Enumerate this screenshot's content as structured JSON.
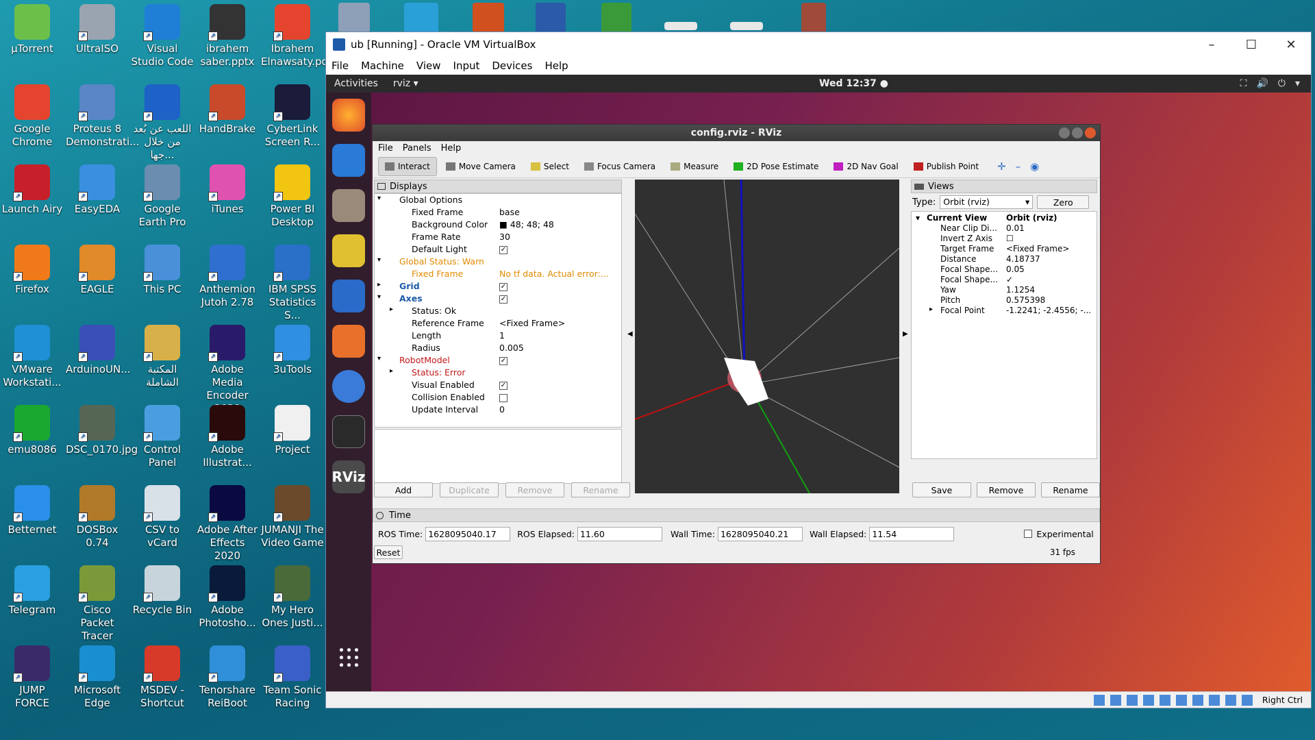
{
  "desktop": {
    "icons": [
      [
        "µTorrent",
        "UltraISO",
        "Visual Studio Code",
        "ibrahem saber.pptx",
        "Ibrahem Elnawsaty.pdf"
      ],
      [
        "Google Chrome",
        "Proteus 8 Demonstrati...",
        "اللعب عن بُعد من خلال جها...",
        "HandBrake",
        "CyberLink Screen R..."
      ],
      [
        "Launch Airy",
        "EasyEDA",
        "Google Earth Pro",
        "iTunes",
        "Power BI Desktop"
      ],
      [
        "Firefox",
        "EAGLE",
        "This PC",
        "Anthemion Jutoh 2.78",
        "IBM SPSS Statistics S..."
      ],
      [
        "VMware Workstati...",
        "ArduinoUN...",
        "المكتبة الشاملة",
        "Adobe Media Encoder 2020",
        "3uTools"
      ],
      [
        "emu8086",
        "DSC_0170.jpg",
        "Control Panel",
        "Adobe Illustrat...",
        "Project"
      ],
      [
        "Betternet",
        "DOSBox 0.74",
        "CSV to vCard",
        "Adobe After Effects 2020",
        "JUMANJI The Video Game"
      ],
      [
        "Telegram",
        "Cisco Packet Tracer",
        "Recycle Bin",
        "Adobe Photosho...",
        "My Hero Ones Justi..."
      ],
      [
        "JUMP FORCE",
        "Microsoft Edge",
        "MSDEV - Shortcut",
        "Tenorshare ReiBoot",
        "Team Sonic Racing"
      ]
    ],
    "icon_colors": [
      [
        "#6cc04a",
        "#9aa4b0",
        "#1f7fd6",
        "#333333",
        "#e5452f"
      ],
      [
        "#e5452f",
        "#5a86c8",
        "#1e62c8",
        "#c84a2a",
        "#1b1b3a"
      ],
      [
        "#c8202a",
        "#3a8fe0",
        "#6b8db0",
        "#e052b0",
        "#f2c511"
      ],
      [
        "#f07a1a",
        "#e08a2a",
        "#4a90d9",
        "#2f6fd0",
        "#2a6fc8"
      ],
      [
        "#1f8fd6",
        "#3a4fb8",
        "#d8b04a",
        "#2a1a6a",
        "#2f8fe0"
      ],
      [
        "#1aa830",
        "#556655",
        "#4a9ee0",
        "#2a0a0a",
        "#f0f0f0"
      ],
      [
        "#2a8fe8",
        "#b07a2a",
        "#d8e0e8",
        "#0a0a40",
        "#6a4a2a"
      ],
      [
        "#2aa0e0",
        "#7a9a3a",
        "#c8d4dc",
        "#0a1a3a",
        "#4a6a3a"
      ],
      [
        "#3a2a6a",
        "#1a8fd0",
        "#d83a2a",
        "#2f8fd8",
        "#3a5fc8"
      ]
    ]
  },
  "vbox": {
    "title": "ub [Running] - Oracle VM VirtualBox",
    "menu": [
      "File",
      "Machine",
      "View",
      "Input",
      "Devices",
      "Help"
    ],
    "controls": [
      "–",
      "☐",
      "✕"
    ],
    "statusbar_right": "Right Ctrl"
  },
  "guest": {
    "activities": "Activities",
    "app": "rviz ▾",
    "clock": "Wed 12:37 ●",
    "tray": [
      "⛶",
      "🔊",
      "⏻",
      "▾"
    ]
  },
  "rviz": {
    "title": "config.rviz - RViz",
    "menu": [
      "File",
      "Panels",
      "Help"
    ],
    "tools": [
      "Interact",
      "Move Camera",
      "Select",
      "Focus Camera",
      "Measure",
      "2D Pose Estimate",
      "2D Nav Goal",
      "Publish Point"
    ],
    "tool_icon_colors": [
      "#777777",
      "#777777",
      "#d8c040",
      "#888888",
      "#aaaa80",
      "#20b020",
      "#c020c0",
      "#c02020"
    ],
    "tools_extra": [
      "✛",
      "–",
      "◉"
    ],
    "displays": {
      "header": "Displays",
      "rows": [
        {
          "k": "Global Options",
          "v": "",
          "lvl": 0,
          "arrow": "▾",
          "cls": ""
        },
        {
          "k": "Fixed Frame",
          "v": "base",
          "lvl": 1,
          "arrow": "",
          "cls": ""
        },
        {
          "k": "Background Color",
          "v": "■ 48; 48; 48",
          "lvl": 1,
          "arrow": "",
          "cls": ""
        },
        {
          "k": "Frame Rate",
          "v": "30",
          "lvl": 1,
          "arrow": "",
          "cls": ""
        },
        {
          "k": "Default Light",
          "v": "✓",
          "lvl": 1,
          "arrow": "",
          "cls": "chk"
        },
        {
          "k": "Global Status: Warn",
          "v": "",
          "lvl": 0,
          "arrow": "▾",
          "cls": "warn"
        },
        {
          "k": "Fixed Frame",
          "v": "No tf data.  Actual error:...",
          "lvl": 1,
          "arrow": "",
          "cls": "warn"
        },
        {
          "k": "Grid",
          "v": "✓",
          "lvl": 0,
          "arrow": "▸",
          "cls": "blue chk"
        },
        {
          "k": "Axes",
          "v": "✓",
          "lvl": 0,
          "arrow": "▾",
          "cls": "blue chk"
        },
        {
          "k": "Status: Ok",
          "v": "",
          "lvl": 1,
          "arrow": "▸",
          "cls": ""
        },
        {
          "k": "Reference Frame",
          "v": "<Fixed Frame>",
          "lvl": 1,
          "arrow": "",
          "cls": ""
        },
        {
          "k": "Length",
          "v": "1",
          "lvl": 1,
          "arrow": "",
          "cls": ""
        },
        {
          "k": "Radius",
          "v": "0.005",
          "lvl": 1,
          "arrow": "",
          "cls": ""
        },
        {
          "k": "RobotModel",
          "v": "✓",
          "lvl": 0,
          "arrow": "▾",
          "cls": "err chk"
        },
        {
          "k": "Status: Error",
          "v": "",
          "lvl": 1,
          "arrow": "▸",
          "cls": "err"
        },
        {
          "k": "Visual Enabled",
          "v": "✓",
          "lvl": 1,
          "arrow": "",
          "cls": "chk"
        },
        {
          "k": "Collision Enabled",
          "v": " ",
          "lvl": 1,
          "arrow": "",
          "cls": "chk"
        },
        {
          "k": "Update Interval",
          "v": "0",
          "lvl": 1,
          "arrow": "",
          "cls": ""
        }
      ],
      "buttons": [
        "Add",
        "Duplicate",
        "Remove",
        "Rename"
      ]
    },
    "views": {
      "header": "Views",
      "type_label": "Type:",
      "type_value": "Orbit (rviz)",
      "zero": "Zero",
      "current_view": "Current View",
      "current_value": "Orbit (rviz)",
      "rows": [
        {
          "k": "Near Clip Di...",
          "v": "0.01"
        },
        {
          "k": "Invert Z Axis",
          "v": "☐"
        },
        {
          "k": "Target Frame",
          "v": "<Fixed Frame>"
        },
        {
          "k": "Distance",
          "v": "4.18737"
        },
        {
          "k": "Focal Shape...",
          "v": "0.05"
        },
        {
          "k": "Focal Shape...",
          "v": "✓"
        },
        {
          "k": "Yaw",
          "v": "1.1254"
        },
        {
          "k": "Pitch",
          "v": "0.575398"
        },
        {
          "k": "Focal Point",
          "v": "-1.2241; -2.4556; -..."
        }
      ],
      "buttons": [
        "Save",
        "Remove",
        "Rename"
      ]
    },
    "time": {
      "header": "Time",
      "ros_time_label": "ROS Time:",
      "ros_time": "1628095040.17",
      "ros_elapsed_label": "ROS Elapsed:",
      "ros_elapsed": "11.60",
      "wall_time_label": "Wall Time:",
      "wall_time": "1628095040.21",
      "wall_elapsed_label": "Wall Elapsed:",
      "wall_elapsed": "11.54",
      "experimental": "Experimental",
      "reset": "Reset",
      "fps": "31 fps"
    }
  }
}
